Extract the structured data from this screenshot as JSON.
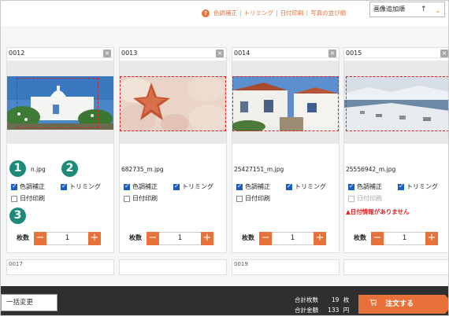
{
  "help_links": {
    "q_icon": "?",
    "items": [
      "色調補正",
      "トリミング",
      "日付印刷",
      "写真の並び順"
    ],
    "separator": "|"
  },
  "sort": {
    "value": "画像追加順",
    "arrow": "↑",
    "chevron": "⌄"
  },
  "cards": [
    {
      "number": "0012",
      "filename": "n.jpg",
      "color_correction": "色調補正",
      "trimming": "トリミング",
      "date_print": "日付印刷",
      "qty_label": "枚数",
      "qty": "1",
      "minus": "−",
      "plus": "+",
      "close": "×"
    },
    {
      "number": "0013",
      "filename": "682735_m.jpg",
      "color_correction": "色調補正",
      "trimming": "トリミング",
      "date_print": "日付印刷",
      "qty_label": "枚数",
      "qty": "1",
      "minus": "−",
      "plus": "+",
      "close": "×"
    },
    {
      "number": "0014",
      "filename": "25427151_m.jpg",
      "color_correction": "色調補正",
      "trimming": "トリミング",
      "date_print": "日付印刷",
      "qty_label": "枚数",
      "qty": "1",
      "minus": "−",
      "plus": "+",
      "close": "×"
    },
    {
      "number": "0015",
      "filename": "25556942_m.jpg",
      "color_correction": "色調補正",
      "trimming": "トリミング",
      "date_print": "日付印刷",
      "warning": "▲日付情報がありません",
      "qty_label": "枚数",
      "qty": "1",
      "minus": "−",
      "plus": "+",
      "close": "×"
    }
  ],
  "bottom_cards": [
    "0017",
    "0019"
  ],
  "badges": [
    "1",
    "2",
    "3"
  ],
  "footer": {
    "bulk_change": "一括変更",
    "total_count_label": "合計枚数",
    "total_count": "19",
    "total_count_unit": "枚",
    "total_amount_label": "合計金額",
    "total_amount": "133",
    "total_amount_unit": "円",
    "order_button": "注文する",
    "cart_icon": "cart-icon"
  },
  "colors": {
    "accent": "#e8713a",
    "badge": "#1d8a7a",
    "warning": "#e02020",
    "checkbox": "#1b5ec2",
    "footer": "#2f2f2f"
  }
}
